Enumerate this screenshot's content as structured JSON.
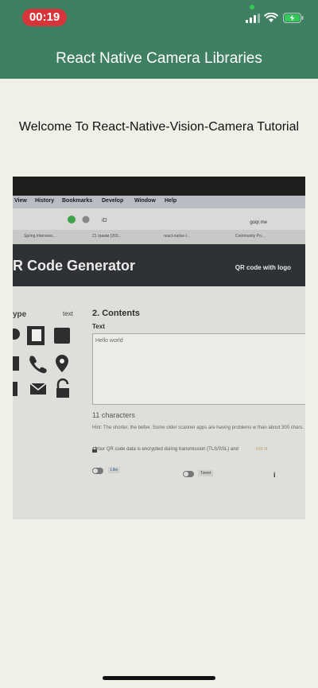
{
  "status_bar": {
    "time": "00:19",
    "icons": [
      "cellular-signal-icon",
      "wifi-icon",
      "battery-charging-icon"
    ],
    "time_pill_color": "#d6333a"
  },
  "nav": {
    "title": "React Native Camera Libraries",
    "background_color": "#3f8062"
  },
  "content": {
    "welcome_text": "Welcome To React-Native-Vision-Camera Tutorial"
  },
  "camera_view": {
    "menu_items": [
      "View",
      "History",
      "Bookmarks",
      "Develop",
      "Window",
      "Help"
    ],
    "url": "goqr.me",
    "tabs": [
      "Spring Interview...",
      "21 грамм (200...",
      "react-native-l...",
      "Community Po..."
    ],
    "site_title": "R Code Generator",
    "site_subtitle": "QR code with logo",
    "type_label": "ype",
    "type_value": "text",
    "contents_title": "2. Contents",
    "field_label": "Text",
    "textarea_value": "Hello world",
    "char_count": "11 characters",
    "hint": "Hint: The shorter, the better. Some older scanner apps are having problems w than about 300 chars.",
    "secure_note": "Your QR code data is encrypted during transmission (TLS/SSL) and",
    "secure_link": "not st",
    "like_label": "Like",
    "tweet_label": "Tweet"
  }
}
